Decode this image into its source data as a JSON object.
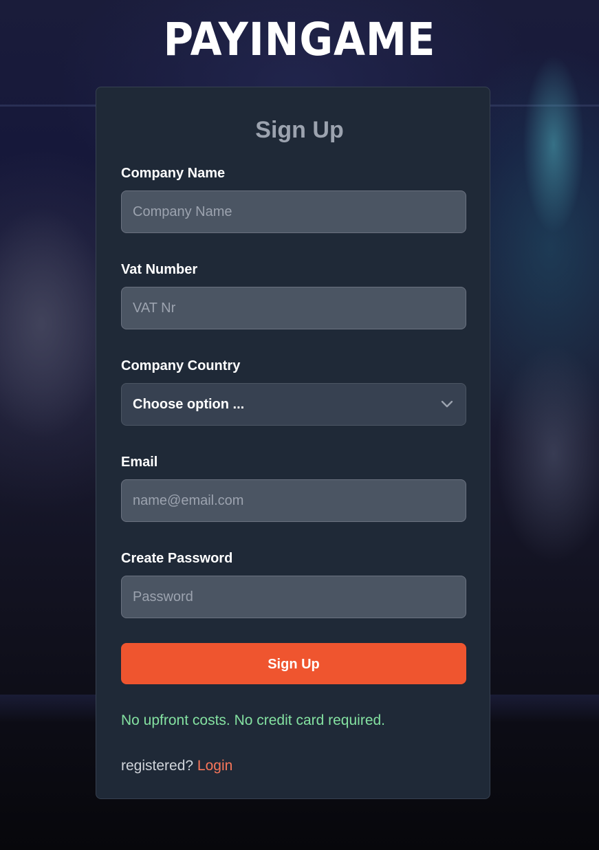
{
  "brand": {
    "logo_text": "PAYINGAME"
  },
  "form": {
    "title": "Sign Up",
    "fields": [
      {
        "label": "Company Name",
        "placeholder": "Company Name",
        "value": ""
      },
      {
        "label": "Vat Number",
        "placeholder": "VAT Nr",
        "value": ""
      },
      {
        "label": "Company Country",
        "selected": "Choose option ..."
      },
      {
        "label": "Email",
        "placeholder": "name@email.com",
        "value": ""
      },
      {
        "label": "Create Password",
        "placeholder": "Password",
        "value": ""
      }
    ],
    "submit_label": "Sign Up",
    "note": "No upfront costs. No credit card required.",
    "footer_text": "registered?",
    "login_link": "Login"
  },
  "colors": {
    "card_bg": "#1f2937",
    "input_bg": "#4b5563",
    "accent": "#ef552f",
    "success_text": "#84e1a1",
    "link": "#f8765a"
  },
  "icons": {
    "select_chevron": "chevron-down-icon"
  }
}
